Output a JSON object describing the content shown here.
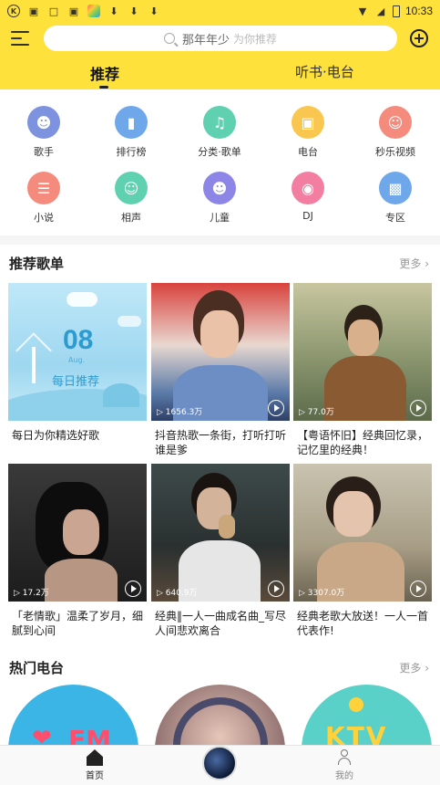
{
  "status_bar": {
    "time": "10:33",
    "left_icons": [
      "k-app-icon",
      "bag-icon",
      "bag-outline-icon",
      "bag-icon-2",
      "photo-app-icon",
      "download-icon",
      "download-icon",
      "download-icon"
    ],
    "right_icons": [
      "wifi-icon",
      "signal-icon",
      "battery-icon"
    ]
  },
  "header": {
    "search_placeholder_main": "那年年少",
    "search_placeholder_sub": "为你推荐",
    "tabs": [
      {
        "label": "推荐",
        "active": true
      },
      {
        "label": "听书·电台",
        "active": false
      }
    ],
    "accent_color": "#ffe13b"
  },
  "grid": [
    {
      "label": "歌手",
      "icon": "singer-icon",
      "color": "#7d93e0"
    },
    {
      "label": "排行榜",
      "icon": "chart-icon",
      "color": "#6fa8ea"
    },
    {
      "label": "分类·歌单",
      "icon": "playlist-icon",
      "color": "#5fd1b0"
    },
    {
      "label": "电台",
      "icon": "radio-icon",
      "color": "#f9c74f"
    },
    {
      "label": "秒乐视频",
      "icon": "video-face-icon",
      "color": "#f48b7c"
    },
    {
      "label": "小说",
      "icon": "novel-icon",
      "color": "#f48b7c"
    },
    {
      "label": "相声",
      "icon": "crosstalk-icon",
      "color": "#5fd1b0"
    },
    {
      "label": "儿童",
      "icon": "kids-icon",
      "color": "#8d86e6"
    },
    {
      "label": "DJ",
      "icon": "dj-disc-icon",
      "color": "#f27fa1"
    },
    {
      "label": "专区",
      "icon": "zone-icon",
      "color": "#6fa8ea"
    }
  ],
  "recommend": {
    "title": "推荐歌单",
    "more": "更多",
    "daily": {
      "day": "08",
      "month": "Aug.",
      "label": "每日推荐"
    },
    "cards": [
      {
        "title": "每日为你精选好歌",
        "count": ""
      },
      {
        "title": "抖音热歌一条街，打听打听谁是爹",
        "count": "1656.3万"
      },
      {
        "title": "【粤语怀旧】经典回忆录，记忆里的经典！",
        "count": "77.0万"
      },
      {
        "title": "「老情歌」温柔了岁月，细腻到心间",
        "count": "17.2万"
      },
      {
        "title": "经典‖一人一曲成名曲_写尽人间悲欢离合",
        "count": "640.9万"
      },
      {
        "title": "经典老歌大放送！一人一首代表作!",
        "count": "3307.0万"
      }
    ]
  },
  "hot_radio": {
    "title": "热门电台",
    "more": "更多",
    "items": [
      {
        "badge": "FM"
      },
      {
        "badge": ""
      },
      {
        "badge": "KTV"
      }
    ]
  },
  "bottom_nav": {
    "home": "首页",
    "mine": "我的"
  }
}
